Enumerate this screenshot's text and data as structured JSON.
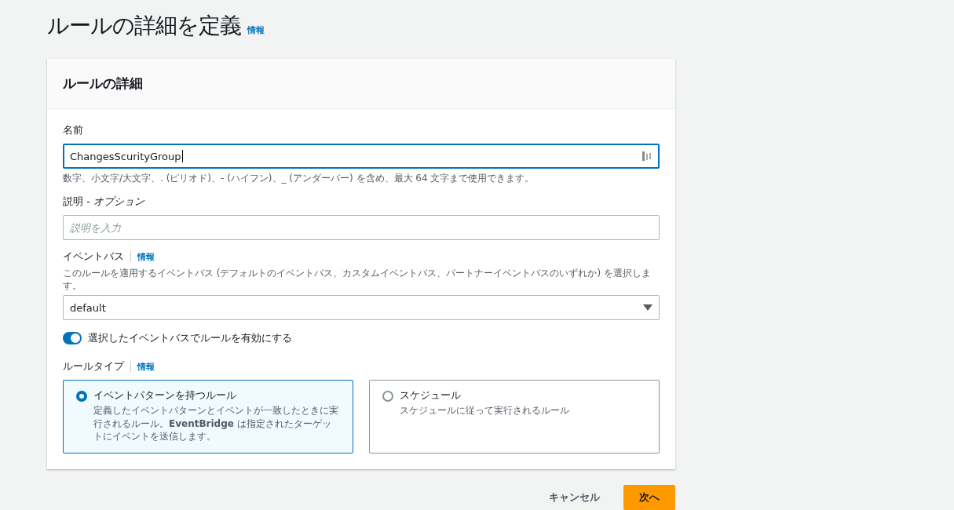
{
  "page": {
    "title": "ルールの詳細を定義",
    "info_link": "情報"
  },
  "card": {
    "title": "ルールの詳細",
    "name_field": {
      "label": "名前",
      "value": "ChangesScurityGroup",
      "hint": "数字、小文字/大文字、. (ピリオド)、- (ハイフン)、_ (アンダーバー) を含め、最大 64 文字まで使用できます。"
    },
    "description_field": {
      "label": "説明 -",
      "label_suffix": "オプション",
      "placeholder": "説明を入力"
    },
    "event_bus": {
      "label": "イベントバス",
      "info_link": "情報",
      "description": "このルールを適用するイベントバス (デフォルトのイベントバス、カスタムイベントバス、パートナーイベントバスのいずれか) を選択します。",
      "value": "default"
    },
    "enable_toggle": {
      "label": "選択したイベントバスでルールを有効にする",
      "on": true
    },
    "rule_type": {
      "label": "ルールタイプ",
      "info_link": "情報",
      "options": [
        {
          "title": "イベントパターンを持つルール",
          "description": "定義したイベントパターンとイベントが一致したときに実行されるルール。**EventBridge** は指定されたターゲットにイベントを送信します。",
          "selected": true
        },
        {
          "title": "スケジュール",
          "description": "スケジュールに従って実行されるルール",
          "selected": false
        }
      ]
    }
  },
  "buttons": {
    "cancel": "キャンセル",
    "next": "次へ"
  }
}
